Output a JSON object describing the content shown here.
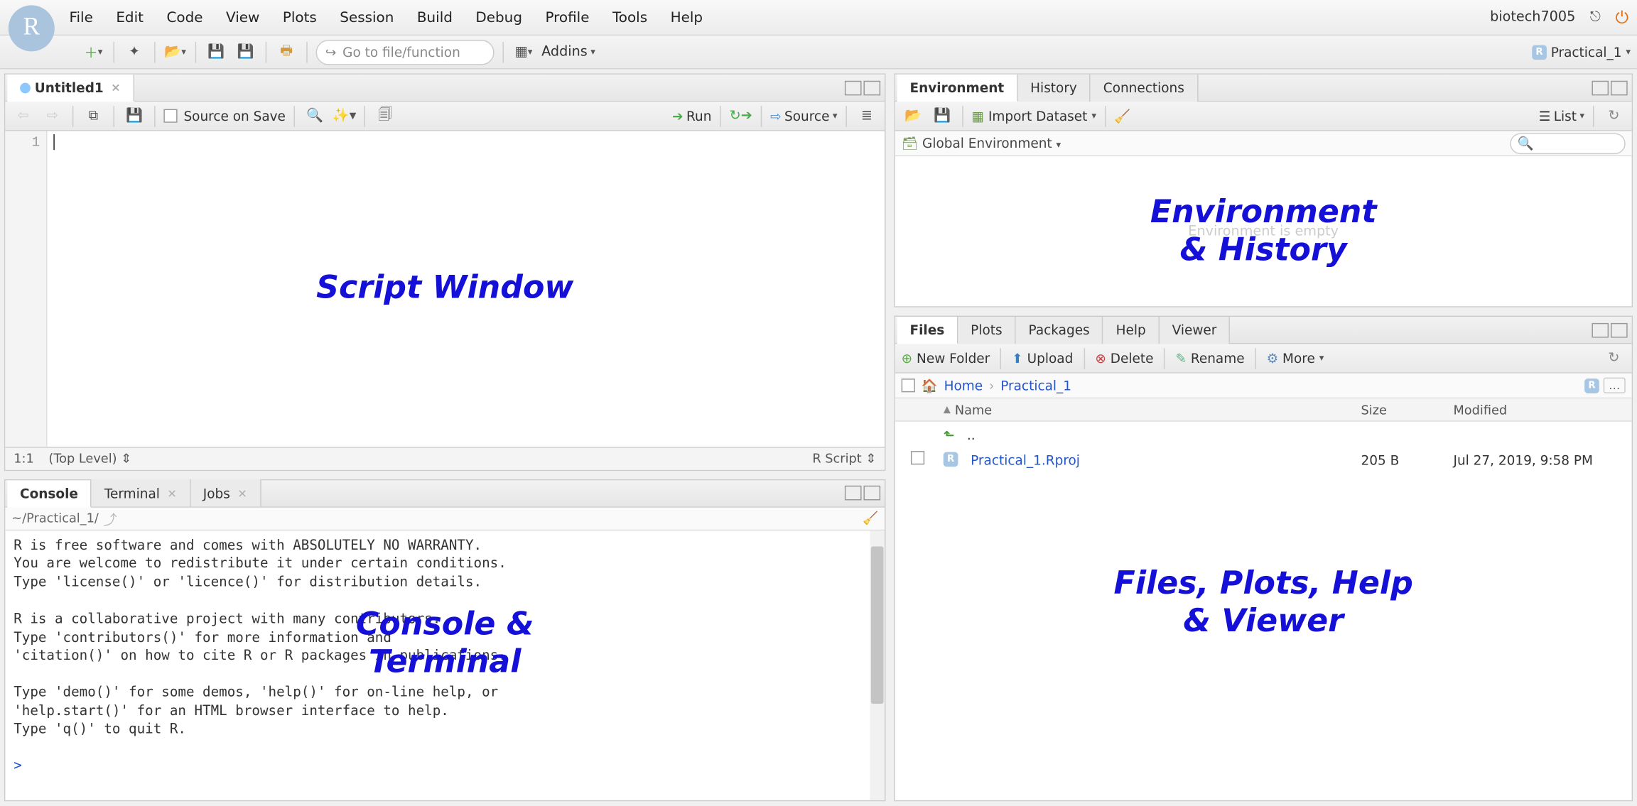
{
  "menubar": [
    "File",
    "Edit",
    "Code",
    "View",
    "Plots",
    "Session",
    "Build",
    "Debug",
    "Profile",
    "Tools",
    "Help"
  ],
  "top_right": {
    "user": "biotech7005"
  },
  "toolbar": {
    "goto_placeholder": "Go to file/function",
    "addins": "Addins",
    "project": "Practical_1"
  },
  "source": {
    "tab_title": "Untitled1",
    "source_on_save": "Source on Save",
    "run": "Run",
    "source_btn": "Source",
    "line": "1",
    "status_pos": "1:1",
    "status_scope": "(Top Level)",
    "status_type": "R Script"
  },
  "console": {
    "tabs": [
      "Console",
      "Terminal",
      "Jobs"
    ],
    "path": "~/Practical_1/",
    "text": "R is free software and comes with ABSOLUTELY NO WARRANTY.\nYou are welcome to redistribute it under certain conditions.\nType 'license()' or 'licence()' for distribution details.\n\nR is a collaborative project with many contributors.\nType 'contributors()' for more information and\n'citation()' on how to cite R or R packages in publications.\n\nType 'demo()' for some demos, 'help()' for on-line help, or\n'help.start()' for an HTML browser interface to help.\nType 'q()' to quit R.\n",
    "prompt": ">"
  },
  "env": {
    "tabs": [
      "Environment",
      "History",
      "Connections"
    ],
    "import": "Import Dataset",
    "list": "List",
    "scope": "Global Environment",
    "empty": "Environment is empty"
  },
  "files": {
    "tabs": [
      "Files",
      "Plots",
      "Packages",
      "Help",
      "Viewer"
    ],
    "tb": {
      "new_folder": "New Folder",
      "upload": "Upload",
      "delete": "Delete",
      "rename": "Rename",
      "more": "More"
    },
    "crumbs": [
      "Home",
      "Practical_1"
    ],
    "cols": {
      "name": "Name",
      "size": "Size",
      "mod": "Modified"
    },
    "up": "..",
    "rows": [
      {
        "name": "Practical_1.Rproj",
        "size": "205 B",
        "mod": "Jul 27, 2019, 9:58 PM"
      }
    ]
  },
  "overlays": {
    "script": "Script Window",
    "console": "Console &\nTerminal",
    "env": "Environment\n& History",
    "files": "Files, Plots, Help\n& Viewer"
  }
}
